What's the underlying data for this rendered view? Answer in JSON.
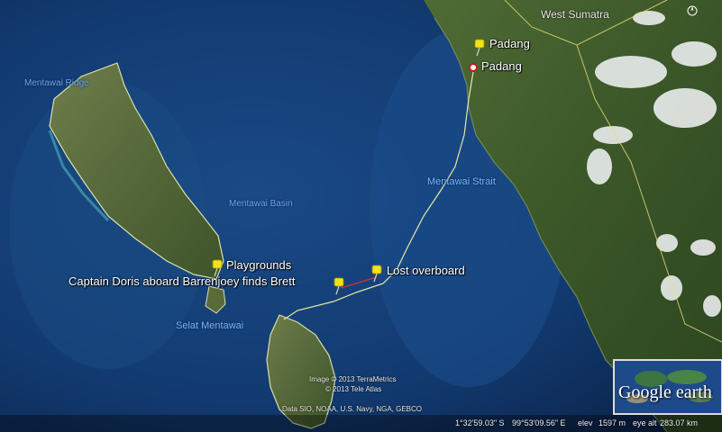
{
  "map": {
    "pins": [
      {
        "id": "padang",
        "label": "Padang"
      },
      {
        "id": "playgrounds",
        "label": "Playgrounds"
      },
      {
        "id": "captain-doris",
        "label": "Captain Doris aboard Barrenjoey finds Brett"
      },
      {
        "id": "lost-overboard",
        "label": "Lost overboard"
      }
    ],
    "city_label": "Padang",
    "region_label": "West Sumatra",
    "water_labels": {
      "mentawai_ridge": "Mentawai Ridge",
      "mentawai_basin": "Mentawai Basin",
      "mentawai_strait": "Mentawai Strait",
      "selat_mentawai": "Selat Mentawai"
    },
    "credits": {
      "line1": "Image © 2013 TerraMetrics",
      "line2": "© 2013 Tele Atlas",
      "line3": "Data SIO, NOAA, U.S. Navy, NGA, GEBCO"
    },
    "logo": "Google earth"
  },
  "status": {
    "lat": "1°32'59.03\" S",
    "lon": "99°53'09.56\" E",
    "elev_label": "elev",
    "elev": "1597 m",
    "eye_label": "eye alt",
    "eye_alt": "283.07 km"
  },
  "colors": {
    "ocean_deep": "#0e2a55",
    "ocean_shallow": "#1d4f8a",
    "land": "#3d5a2c",
    "track_line": "#e6e8a8",
    "pin": "#f2e21a",
    "drift_line": "#d83030"
  }
}
